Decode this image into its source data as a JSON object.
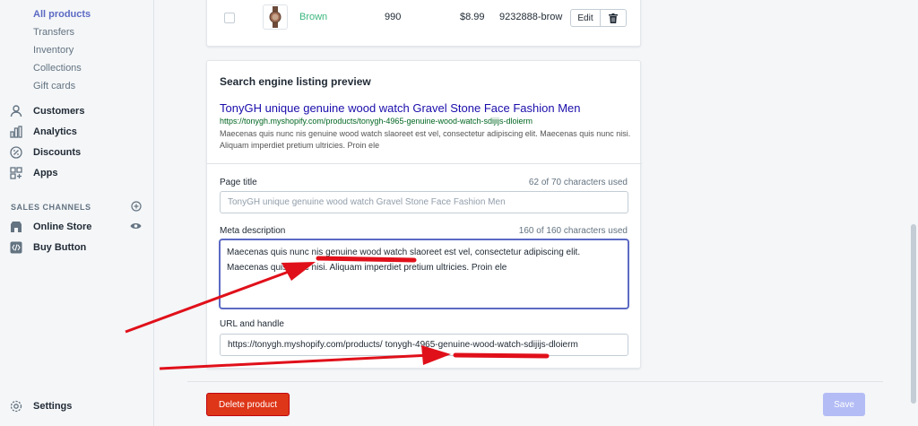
{
  "sidebar": {
    "sub_items": [
      "All products",
      "Transfers",
      "Inventory",
      "Collections",
      "Gift cards"
    ],
    "items": [
      {
        "label": "Customers",
        "icon": "person-icon"
      },
      {
        "label": "Analytics",
        "icon": "bar-chart-icon"
      },
      {
        "label": "Discounts",
        "icon": "discount-icon"
      },
      {
        "label": "Apps",
        "icon": "apps-icon"
      }
    ],
    "sales_channels_heading": "SALES CHANNELS",
    "channels": [
      {
        "label": "Online Store",
        "icon": "store-icon"
      },
      {
        "label": "Buy Button",
        "icon": "code-icon"
      }
    ],
    "settings_label": "Settings"
  },
  "variant_row": {
    "name": "Brown",
    "quantity": "990",
    "price": "$8.99",
    "sku": "9232888-brow",
    "edit_label": "Edit"
  },
  "seo": {
    "heading": "Search engine listing preview",
    "preview_title": "TonyGH unique genuine wood watch Gravel Stone Face Fashion Men",
    "preview_url": "https://tonygh.myshopify.com/products/tonygh-4965-genuine-wood-watch-sdijijs-dloierm",
    "preview_description": "Maecenas quis nunc nis genuine wood watch slaoreet est vel, consectetur adipiscing elit. Maecenas quis nunc nisi. Aliquam imperdiet pretium ultricies. Proin ele",
    "page_title_label": "Page title",
    "page_title_counter": "62 of 70 characters used",
    "page_title_placeholder": "TonyGH unique genuine wood watch Gravel Stone Face Fashion Men",
    "meta_label": "Meta description",
    "meta_counter": "160 of 160 characters used",
    "meta_line1": "Maecenas quis nunc nis genuine wood watch slaoreet est vel, consectetur adipiscing elit.",
    "meta_line2": "Maecenas quis nunc nisi. Aliquam imperdiet pretium ultricies. Proin ele",
    "url_label": "URL and handle",
    "url_prefix": "https://tonygh.myshopify.com/products/",
    "url_handle": "tonygh-4965-genuine-wood-watch-sdijijs-dloierm"
  },
  "footer": {
    "delete_label": "Delete product",
    "save_label": "Save"
  },
  "colors": {
    "accent": "#5c6ac4",
    "danger": "#de3618",
    "annotation": "#e0101a"
  }
}
